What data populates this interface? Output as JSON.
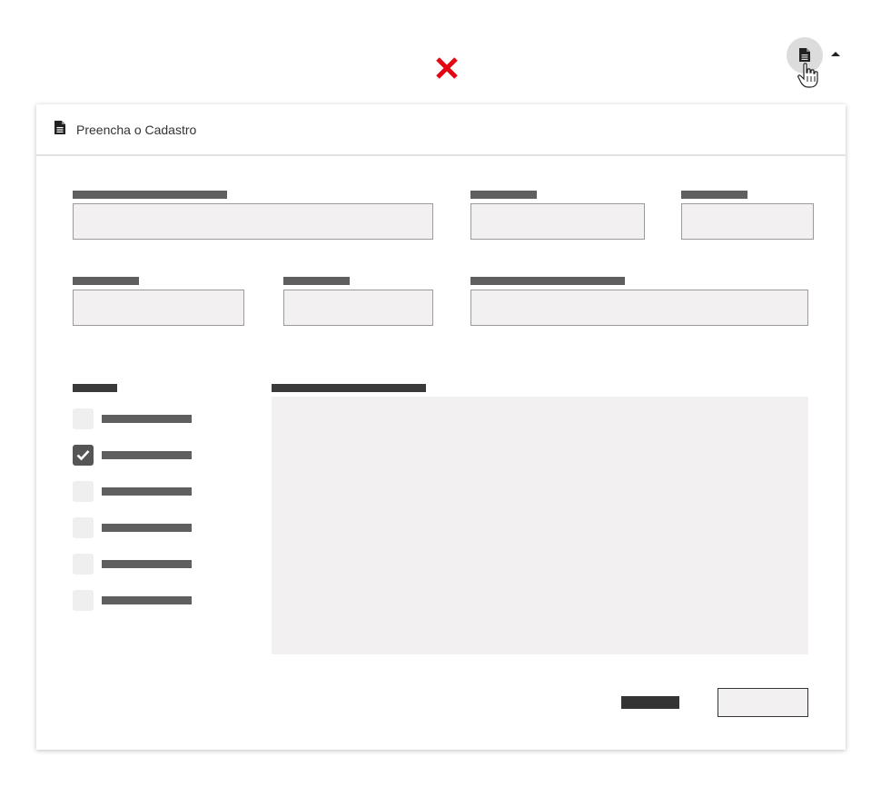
{
  "window": {
    "close_icon": "close-x-icon",
    "close_color": "#e30613",
    "doc_button_icon": "document-icon",
    "dropdown_icon": "caret-up-icon",
    "cursor_icon": "hand-pointer-icon"
  },
  "panel": {
    "title": "Preencha o Cadastro",
    "title_icon": "document-icon"
  },
  "form": {
    "fields_row1": [
      "field-1",
      "field-2",
      "field-3"
    ],
    "fields_row2": [
      "field-4",
      "field-5",
      "field-6"
    ],
    "checkboxes": [
      {
        "checked": false
      },
      {
        "checked": true
      },
      {
        "checked": false
      },
      {
        "checked": false
      },
      {
        "checked": false
      },
      {
        "checked": false
      }
    ]
  },
  "colors": {
    "field_bg": "#f2f0f1",
    "label_bar": "#5f5f5f",
    "accent_dark": "#333333"
  }
}
